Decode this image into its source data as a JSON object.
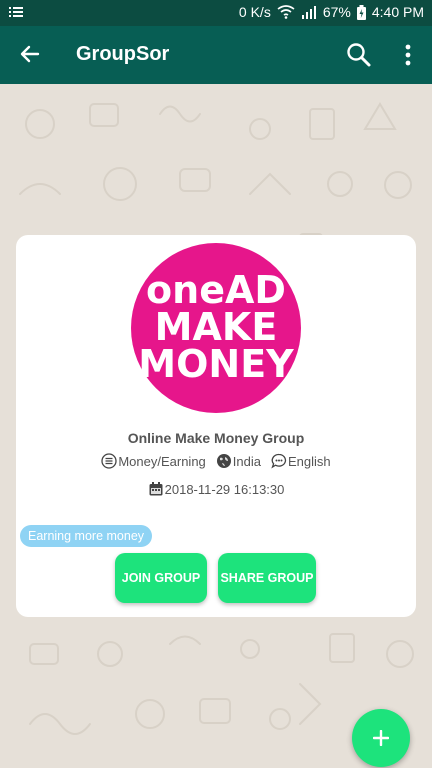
{
  "status_bar": {
    "network_speed": "0 K/s",
    "battery": "67%",
    "time": "4:40 PM",
    "icons": [
      "notification-list-icon",
      "wifi-icon",
      "signal-icon",
      "battery-charging-icon"
    ]
  },
  "app_bar": {
    "title": "GroupSor",
    "icons": [
      "back-arrow-icon",
      "search-icon",
      "more-vert-icon"
    ]
  },
  "group": {
    "logo_text_lines": [
      "oneAD",
      "MAKE",
      "MONEY"
    ],
    "name": "Online Make Money Group",
    "category": "Money/Earning",
    "country": "India",
    "language": "English",
    "created": "2018-11-29 16:13:30",
    "tag": "Earning more money"
  },
  "buttons": {
    "join": "JOIN GROUP",
    "share": "SHARE GROUP"
  },
  "fab": {
    "icon": "plus-icon"
  },
  "colors": {
    "status_bar": "#0c4c41",
    "app_bar": "#075e54",
    "background": "#e6e0d8",
    "card": "#ffffff",
    "accent_green": "#1de37c",
    "tag_blue": "#8fd3f4",
    "logo_pink": "#e6168b"
  }
}
